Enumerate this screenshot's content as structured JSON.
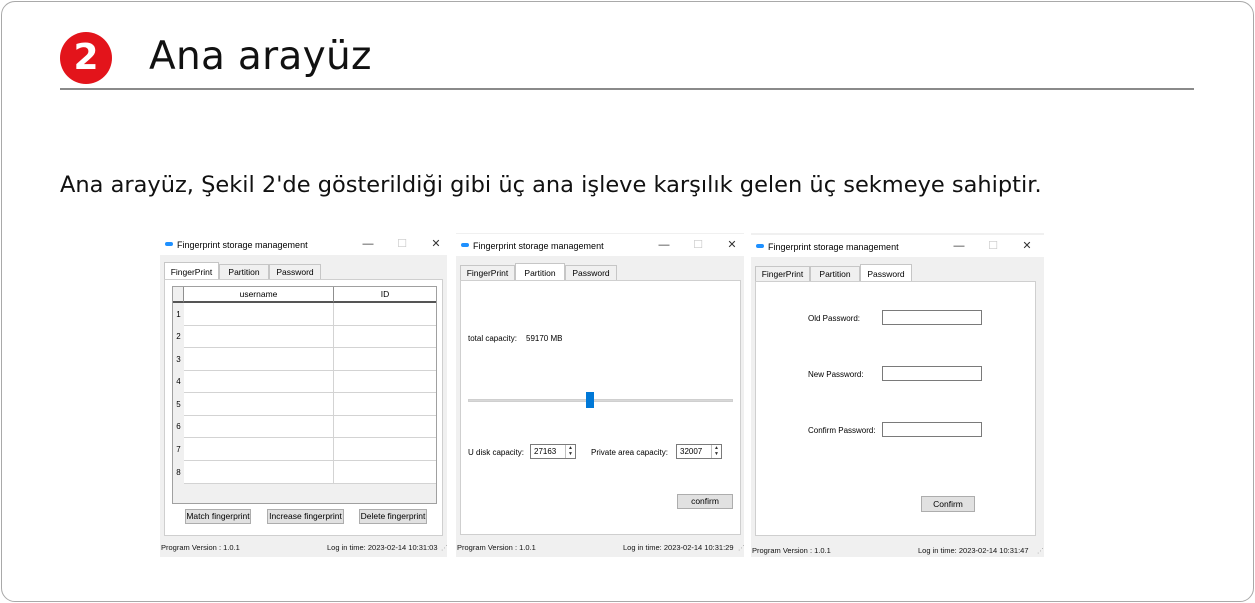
{
  "header": {
    "step_number": "2",
    "title": "Ana arayüz",
    "intro": "Ana arayüz, Şekil 2'de gösterildiği gibi üç ana işleve karşılık gelen üç sekmeye sahiptir."
  },
  "colors": {
    "badge": "#e3141b",
    "slider_thumb": "#0078d7",
    "app_icon": "#1e90ff"
  },
  "window_common": {
    "title": "Fingerprint storage management",
    "minimize": "—",
    "maximize": "☐",
    "close": "✕",
    "tabs": [
      "FingerPrint",
      "Partition",
      "Password"
    ],
    "program_version": "Program Version : 1.0.1",
    "grip": "⋰"
  },
  "window1": {
    "active_tab": "FingerPrint",
    "columns": [
      "username",
      "ID"
    ],
    "rows": [
      "1",
      "2",
      "3",
      "4",
      "5",
      "6",
      "7",
      "8"
    ],
    "buttons": [
      "Match fingerprint",
      "Increase fingerprint",
      "Delete fingerprint"
    ],
    "log_time": "Log in time: 2023-02-14  10:31:03"
  },
  "window2": {
    "active_tab": "Partition",
    "total_capacity_label": "total capacity:",
    "total_capacity_value": "59170 MB",
    "slider_fraction": 0.46,
    "udisk_label": "U disk capacity:",
    "udisk_value": "27163",
    "private_label": "Private area capacity:",
    "private_value": "32007",
    "confirm": "confirm",
    "log_time": "Log in time: 2023-02-14  10:31:29"
  },
  "window3": {
    "active_tab": "Password",
    "old_label": "Old Password:",
    "new_label": "New Password:",
    "confirm_label": "Confirm Password:",
    "confirm_button": "Confirm",
    "log_time": "Log in time: 2023-02-14  10:31:47"
  }
}
